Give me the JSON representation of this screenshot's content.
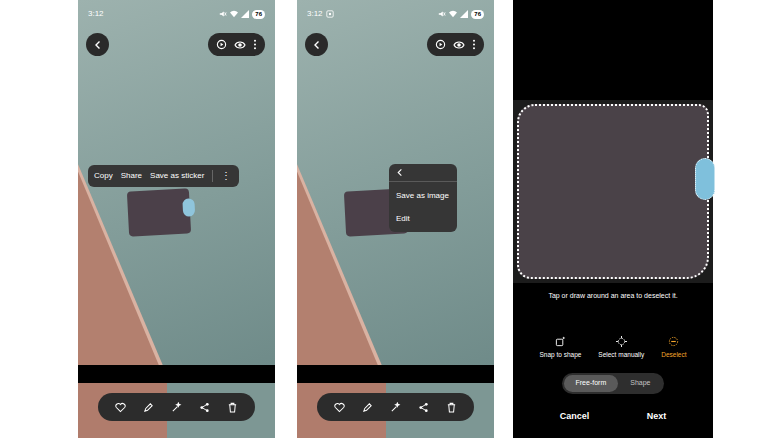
{
  "screens": [
    {
      "status": {
        "time": "3:12",
        "battery": "76"
      },
      "menu": [
        {
          "label": "Copy"
        },
        {
          "label": "Share"
        },
        {
          "label": "Save as sticker"
        },
        {
          "label": "⋮"
        }
      ]
    },
    {
      "status": {
        "time": "3:12",
        "battery": "76"
      },
      "menu": [
        {
          "label": "Save as image"
        },
        {
          "label": "Edit"
        }
      ]
    }
  ],
  "editor": {
    "hint": "Tap or draw around an area to deselect it.",
    "tools": [
      {
        "label": "Snap to shape",
        "selected": false
      },
      {
        "label": "Select manually",
        "selected": false
      },
      {
        "label": "Deselect",
        "selected": true
      }
    ],
    "modes": [
      {
        "label": "Free-form",
        "selected": true
      },
      {
        "label": "Shape",
        "selected": false
      }
    ],
    "actions": [
      "Cancel",
      "Next"
    ]
  }
}
